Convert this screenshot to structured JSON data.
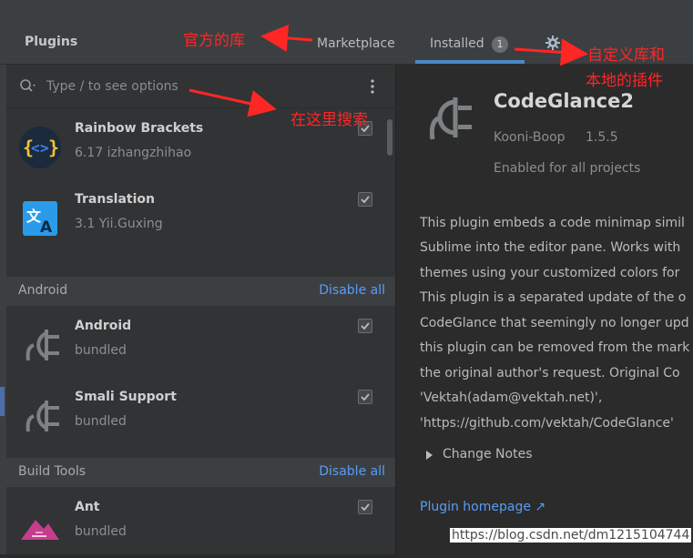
{
  "header": {
    "title": "Plugins",
    "tabs": [
      {
        "label": "Marketplace"
      },
      {
        "label": "Installed",
        "badge": "1"
      }
    ]
  },
  "annotations": {
    "official": "官方的库",
    "custom_line1": "自定义库和",
    "custom_line2": "本地的插件",
    "search_here": "在这里搜索"
  },
  "search": {
    "placeholder": "Type / to see options"
  },
  "groups": {
    "android": {
      "label": "Android",
      "action": "Disable all"
    },
    "build_tools": {
      "label": "Build Tools",
      "action": "Disable all"
    }
  },
  "plugins": [
    {
      "name": "Rainbow Brackets",
      "sub": "6.17  izhangzhihao",
      "enabled": true
    },
    {
      "name": "Translation",
      "sub": "3.1  Yii.Guxing",
      "enabled": true
    },
    {
      "name": "Android",
      "sub": "bundled",
      "enabled": true
    },
    {
      "name": "Smali Support",
      "sub": "bundled",
      "enabled": true
    },
    {
      "name": "Ant",
      "sub": "bundled",
      "enabled": true
    }
  ],
  "detail": {
    "name": "CodeGlance2",
    "vendor": "Kooni-Boop",
    "version": "1.5.5",
    "status": "Enabled for all projects",
    "description": [
      "This plugin embeds a code minimap simil",
      "Sublime into the editor pane. Works with",
      "themes using your customized colors for",
      "This plugin is a separated update of the o",
      "CodeGlance that seemingly no longer upd",
      "this plugin can be removed from the mark",
      "the original author's request. Original Co",
      "'Vektah(adam@vektah.net)',",
      "'https://github.com/vektah/CodeGlance'"
    ],
    "change_notes": "Change Notes",
    "homepage": "Plugin homepage ↗"
  },
  "watermark": "https://blog.csdn.net/dm1215104744",
  "colors": {
    "accent": "#4a88c7",
    "link": "#589df6",
    "annotation": "#ff2626"
  }
}
